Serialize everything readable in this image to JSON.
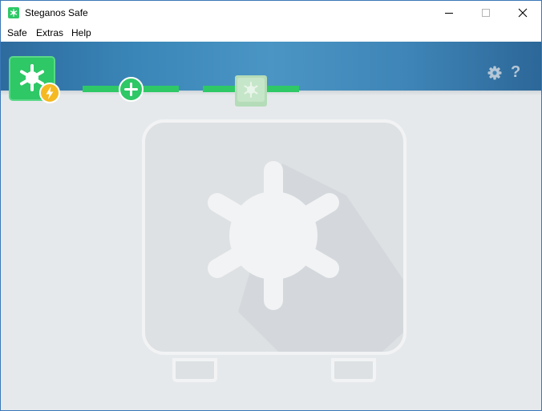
{
  "window": {
    "title": "Steganos Safe",
    "controls": [
      "minimize",
      "maximize",
      "close"
    ]
  },
  "menu": {
    "items": [
      "Safe",
      "Extras",
      "Help"
    ]
  },
  "toolbar": {
    "steps": [
      {
        "name": "quick-safe",
        "icon": "safe-icon",
        "badge": "lightning-icon"
      },
      {
        "name": "create",
        "icon": "plus-icon"
      },
      {
        "name": "safe",
        "icon": "safe-icon"
      }
    ],
    "settings_icon": "gear-icon",
    "help_label": "?"
  },
  "colors": {
    "accent": "#2ec866",
    "banner": "#3a86b8",
    "badge": "#f5b921",
    "background": "#e6e9ec",
    "watermark": "#f2f3f4"
  }
}
